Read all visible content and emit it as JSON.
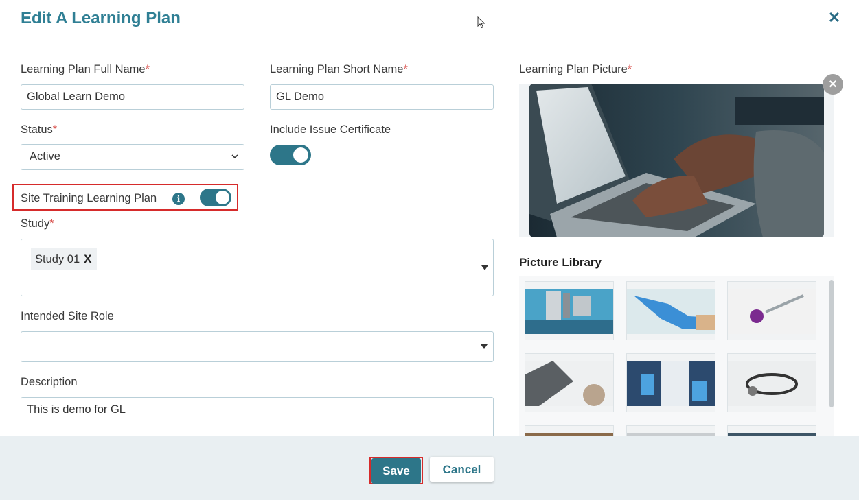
{
  "dialog": {
    "title": "Edit A Learning Plan"
  },
  "form": {
    "full_name": {
      "label": "Learning Plan Full Name",
      "value": "Global Learn Demo"
    },
    "short_name": {
      "label": "Learning Plan Short Name",
      "value": "GL Demo"
    },
    "status": {
      "label": "Status",
      "value": "Active"
    },
    "issue_certificate": {
      "label": "Include Issue Certificate",
      "on": true
    },
    "site_training": {
      "label": "Site Training Learning Plan",
      "on": true
    },
    "study": {
      "label": "Study",
      "chips": [
        "Study 01"
      ],
      "chip_remove": "X"
    },
    "site_role": {
      "label": "Intended Site Role",
      "value": ""
    },
    "description": {
      "label": "Description",
      "value": "This is demo for GL"
    },
    "required_mark": "*"
  },
  "picture": {
    "label": "Learning Plan Picture",
    "library_title": "Picture Library",
    "thumbnails": [
      "microscope",
      "blue-glove",
      "virus-syringe",
      "laptop-desk",
      "lab-scientist",
      "stethoscope"
    ]
  },
  "footer": {
    "save_label": "Save",
    "cancel_label": "Cancel"
  },
  "colors": {
    "primary": "#2d7689",
    "title": "#2f7f94",
    "required": "#d9534f",
    "highlight": "#d62b2b",
    "footer_bg": "#e9eff2"
  }
}
